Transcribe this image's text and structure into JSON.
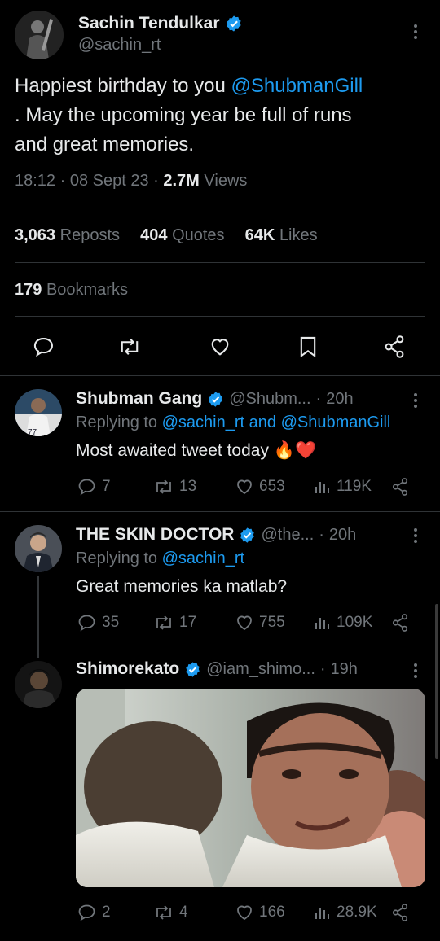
{
  "main_tweet": {
    "author_name": "Sachin Tendulkar",
    "handle": "@sachin_rt",
    "text_line1_pre": "Happiest birthday to you ",
    "text_mention": "@ShubmanGill",
    "text_line2": ". May the upcoming year be full of runs",
    "text_line3": "and great memories.",
    "time": "18:12",
    "date": "08 Sept 23",
    "views_value": "2.7M",
    "views_label": "Views",
    "reposts_value": "3,063",
    "reposts_label": "Reposts",
    "quotes_value": "404",
    "quotes_label": "Quotes",
    "likes_value": "64K",
    "likes_label": "Likes",
    "bookmarks_value": "179",
    "bookmarks_label": "Bookmarks"
  },
  "replies": [
    {
      "name": "Shubman Gang",
      "handle": "@Shubm...",
      "age": "20h",
      "replying_prefix": "Replying to ",
      "replying_to": "@sachin_rt and @ShubmanGill",
      "text": "Most awaited tweet today 🔥❤️",
      "replies": "7",
      "reposts": "13",
      "likes": "653",
      "views": "119K"
    },
    {
      "name": "THE SKIN DOCTOR",
      "handle": "@the...",
      "age": "20h",
      "replying_prefix": "Replying to ",
      "replying_to": "@sachin_rt",
      "text": "Great memories ka matlab?",
      "replies": "35",
      "reposts": "17",
      "likes": "755",
      "views": "109K"
    },
    {
      "name": "Shimorekato",
      "handle": "@iam_shimo...",
      "age": "19h",
      "replies": "2",
      "reposts": "4",
      "likes": "166",
      "views": "28.9K"
    }
  ],
  "colors": {
    "background": "#000000",
    "text": "#e7e9ea",
    "muted": "#71767b",
    "accent": "#1d9bf0",
    "divider": "#2f3336"
  },
  "icons": [
    "verified-badge-icon",
    "more-icon",
    "reply-icon",
    "repost-icon",
    "like-icon",
    "bookmark-icon",
    "share-icon",
    "views-icon"
  ]
}
